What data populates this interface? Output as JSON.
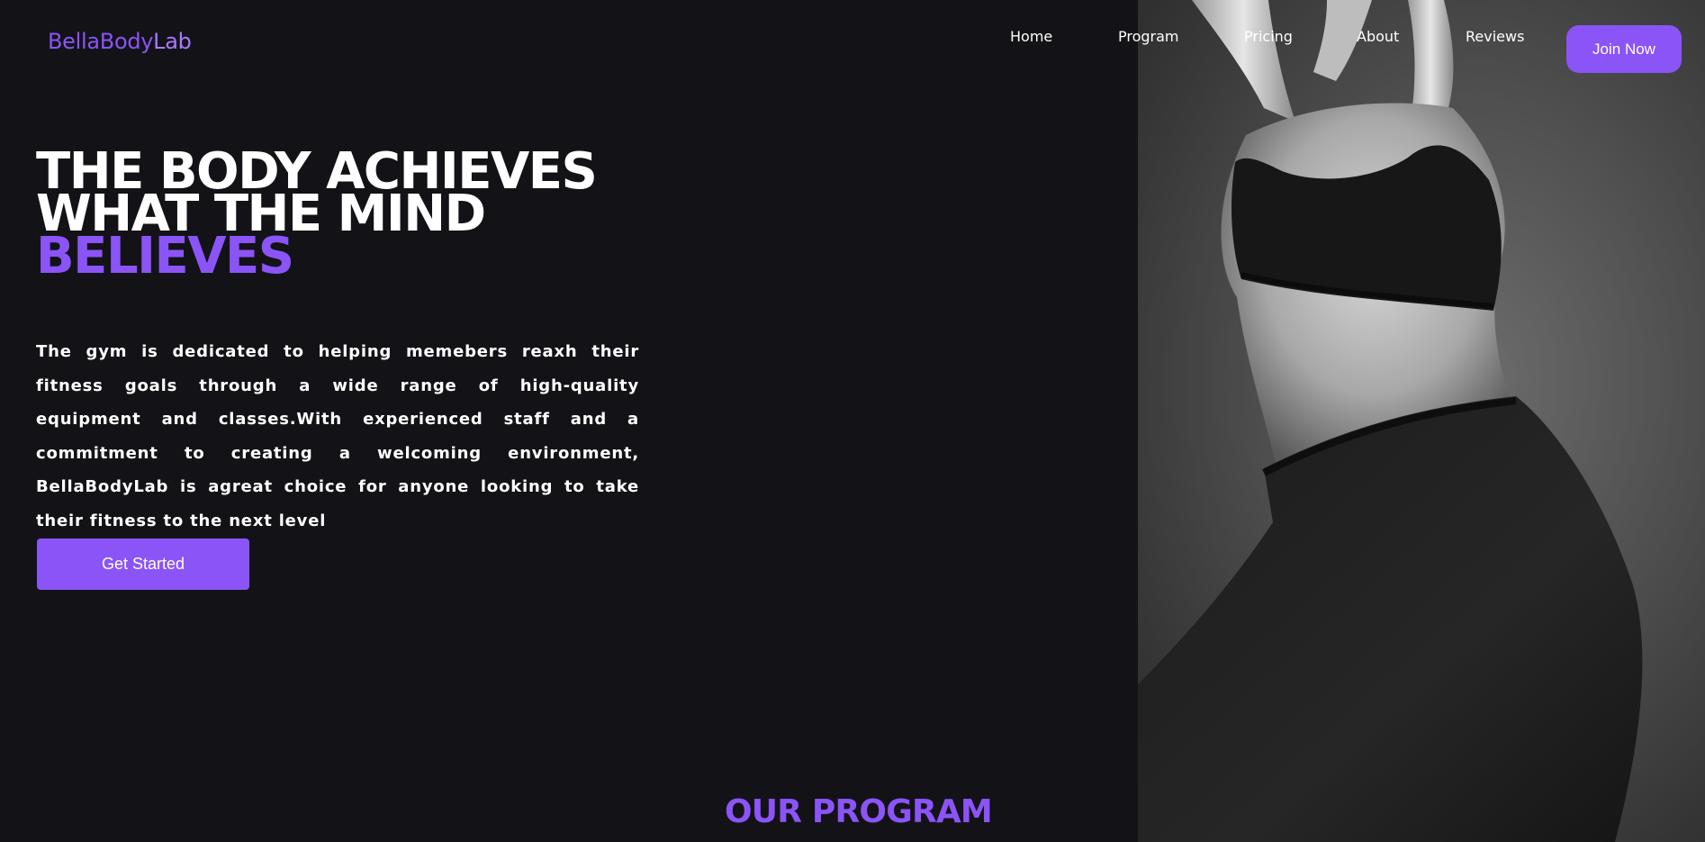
{
  "brand": {
    "logo_part1": "BellaBody",
    "logo_part2": "Lab",
    "accent_color": "#8b54f7",
    "background_color": "#131317"
  },
  "nav": {
    "items": [
      {
        "label": "Home"
      },
      {
        "label": "Program"
      },
      {
        "label": "Pricing"
      },
      {
        "label": "About"
      },
      {
        "label": "Reviews"
      }
    ],
    "cta_label": "Join Now"
  },
  "hero": {
    "headline_line1": "THE BODY ACHIEVES",
    "headline_line2": "WHAT THE MIND",
    "headline_accent": "BELIEVES",
    "description": "The gym is dedicated to helping memebers reaxh their fitness goals through a wide range of high-quality equipment and classes.With experienced staff and a commitment to creating a welcoming environment, BellaBodyLab is agreat choice for anyone looking to take their fitness to the next level",
    "cta_label": "Get Started",
    "image_icon": "fitness-model-photo"
  },
  "program_section": {
    "title": "OUR PROGRAM"
  }
}
